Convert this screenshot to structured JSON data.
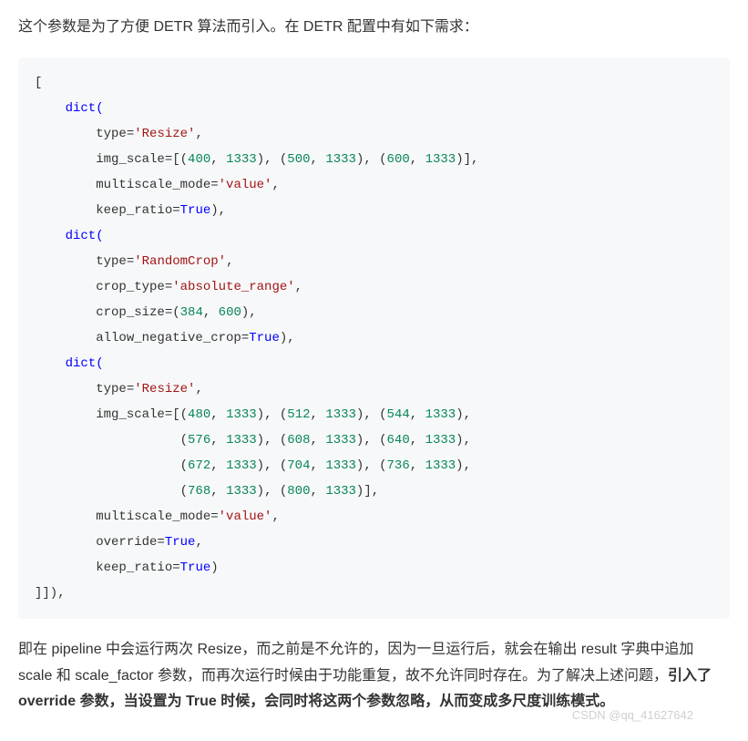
{
  "intro": "这个参数是为了方便 DETR 算法而引入。在 DETR 配置中有如下需求：",
  "code": {
    "open_bracket": "[",
    "d1": {
      "dict_open": "    dict(",
      "type_key": "        type",
      "eq": "=",
      "type_val": "'Resize'",
      "comma": ",",
      "img_scale_key": "        img_scale",
      "img_scale_open": "=[(",
      "n400": "400",
      "n1333a": "1333",
      "sep1": "), (",
      "n500": "500",
      "n1333b": "1333",
      "sep2": "), (",
      "n600": "600",
      "n1333c": "1333",
      "img_scale_close": ")],",
      "multi_key": "        multiscale_mode",
      "multi_val": "'value'",
      "keep_key": "        keep_ratio",
      "true": "True",
      "close": "),"
    },
    "d2": {
      "dict_open": "    dict(",
      "type_key": "        type",
      "type_val": "'RandomCrop'",
      "crop_type_key": "        crop_type",
      "crop_type_val": "'absolute_range'",
      "crop_size_key": "        crop_size",
      "n384": "384",
      "n600": "600",
      "allow_key": "        allow_negative_crop",
      "true": "True",
      "close": "),"
    },
    "d3": {
      "dict_open": "    dict(",
      "type_key": "        type",
      "type_val": "'Resize'",
      "img_scale_key": "        img_scale",
      "n480": "480",
      "n512": "512",
      "n544": "544",
      "n576": "576",
      "n608": "608",
      "n640": "640",
      "n672": "672",
      "n704": "704",
      "n736": "736",
      "n768": "768",
      "n800": "800",
      "n1333": "1333",
      "multi_key": "        multiscale_mode",
      "multi_val": "'value'",
      "override_key": "        override",
      "keep_key": "        keep_ratio",
      "true": "True",
      "close": ")"
    },
    "close_bracket": "]]),"
  },
  "outro": {
    "p1": "即在 pipeline 中会运行两次 Resize，而之前是不允许的，因为一旦运行后，就会在输出 result 字典中追加 scale 和 scale_factor 参数，而再次运行时候由于功能重复，故不允许同时存在。为了解决上述问题，",
    "bold": "引入了 override 参数，当设置为 True 时候，会同时将这两个参数忽略，从而变成多尺度训练模式。"
  },
  "watermark": "CSDN @qq_41627642"
}
